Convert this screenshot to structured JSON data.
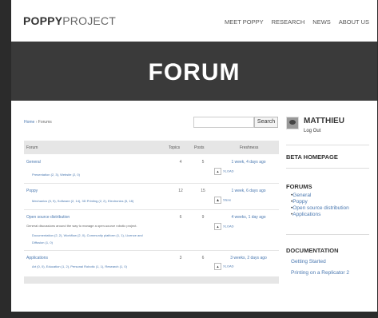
{
  "logo": {
    "bold": "POPPY",
    "light": "PROJECT"
  },
  "nav": [
    "MEET POPPY",
    "RESEARCH",
    "NEWS",
    "ABOUT US"
  ],
  "hero_title": "FORUM",
  "breadcrumb": {
    "home": "Home",
    "sep": "›",
    "current": "Forums"
  },
  "search": {
    "button": "Search",
    "value": ""
  },
  "table": {
    "headers": {
      "forum": "Forum",
      "topics": "Topics",
      "posts": "Posts",
      "freshness": "Freshness"
    },
    "rows": [
      {
        "title": "General",
        "topics": "4",
        "posts": "5",
        "freshness": "1 week, 4 days ago",
        "author": "XLOAD",
        "desc": "",
        "sub": "Presentation (2, 3), Website (2, 0)"
      },
      {
        "title": "Poppy",
        "topics": "12",
        "posts": "15",
        "freshness": "1 week, 6 days ago",
        "author": "Steve",
        "desc": "",
        "sub": "Mechanics (5, 9), Software (2, 14), 3D Printing (2, 2), Electronics (5, 18)"
      },
      {
        "title": "Open source distribution",
        "topics": "6",
        "posts": "9",
        "freshness": "4 weeks, 1 day ago",
        "author": "XLOAD",
        "desc": "General discussions around the way to manage a open-source robotic project.",
        "sub1": "Documentation (2, 2), Workflow (2, 0), Community platform (1, 1), Licence and",
        "sub2": "Diffusion (1, 0)"
      },
      {
        "title": "Applications",
        "topics": "3",
        "posts": "6",
        "freshness": "3 weeks, 2 days ago",
        "author": "XLOAD",
        "desc": "",
        "sub": "Art (0, 0), Education (1, 2), Personal Robotic (1, 1), Research (1, 0)"
      }
    ]
  },
  "sidebar": {
    "username": "MATTHIEU",
    "logout": "Log Out",
    "beta": "BETA HOMEPAGE",
    "forums_title": "FORUMS",
    "forums": [
      "General",
      "Poppy",
      "Open source distribution",
      "Applications"
    ],
    "doc_title": "DOCUMENTATION",
    "docs": [
      "Getting Started",
      "Printing on a Replicator 2"
    ]
  }
}
